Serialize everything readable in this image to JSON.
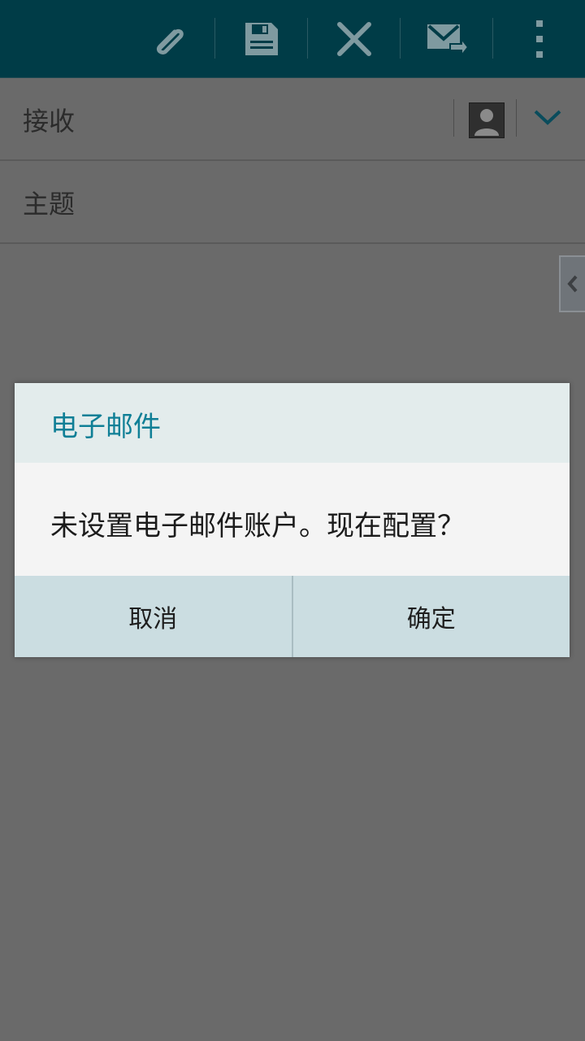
{
  "toolbar": {
    "icons": [
      "paperclip-icon",
      "save-icon",
      "close-icon",
      "send-mail-icon",
      "more-vert-icon"
    ]
  },
  "compose": {
    "to_label": "接收",
    "subject_label": "主题"
  },
  "dialog": {
    "title": "电子邮件",
    "message": "未设置电子邮件账户。现在配置？",
    "cancel_label": "取消",
    "ok_label": "确定"
  },
  "colors": {
    "toolbar_bg": "#003c47",
    "dialog_title": "#0f7f96",
    "dialog_buttons_bg": "#cbdde1"
  }
}
